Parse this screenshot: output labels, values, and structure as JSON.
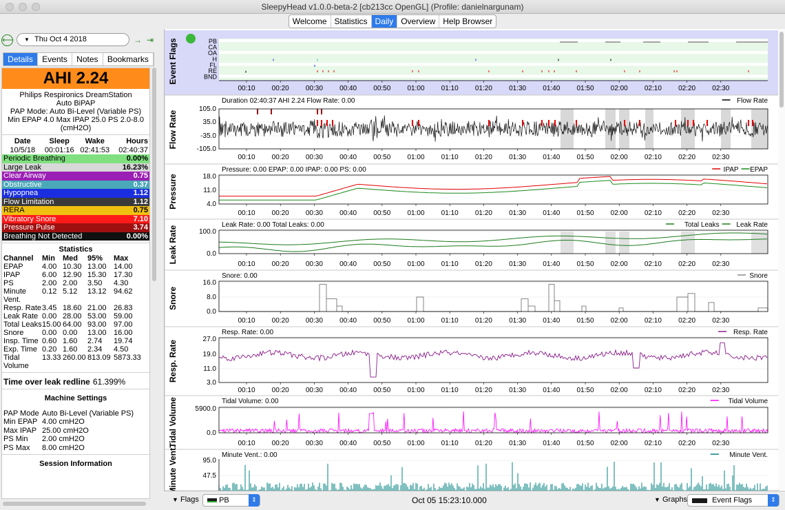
{
  "window": {
    "title": "SleepyHead v1.0.0-beta-2 [cb213cc OpenGL] (Profile: danielnargunam)"
  },
  "tabs": [
    "Welcome",
    "Statistics",
    "Daily",
    "Overview",
    "Help Browser"
  ],
  "active_tab": "Daily",
  "nav": {
    "date": "Thu Oct 4 2018",
    "back_icon": "back-arrow-icon",
    "forward_icon": "forward-arrow-icon",
    "last_icon": "jump-end-icon"
  },
  "left_tabs": [
    "Details",
    "Events",
    "Notes",
    "Bookmarks"
  ],
  "active_left_tab": "Details",
  "ahi": "AHI 2.24",
  "machine": {
    "name": "Philips Respironics DreamStation",
    "model": "Auto BiPAP",
    "mode_line": "PAP Mode: Auto Bi-Level (Variable PS)",
    "pressure_line": "Min EPAP 4.0 Max IPAP 25.0 PS 2.0-8.0",
    "unit": "(cmH2O)"
  },
  "sleep": {
    "headers": [
      "Date",
      "Sleep",
      "Wake",
      "Hours"
    ],
    "values": [
      "10/5/18",
      "00:01:16",
      "02:41:53",
      "02:40:37"
    ]
  },
  "events": [
    {
      "name": "Periodic Breathing",
      "value": "0.00%",
      "bg": "#80e080",
      "fg": "#000000"
    },
    {
      "name": "Large Leak",
      "value": "16.23%",
      "bg": "#d8d8d8",
      "fg": "#000000"
    },
    {
      "name": "Clear Airway",
      "value": "0.75",
      "bg": "#9a1fb4",
      "fg": "#ffffff"
    },
    {
      "name": "Obstructive",
      "value": "0.37",
      "bg": "#4aa8b8",
      "fg": "#ffffff"
    },
    {
      "name": "Hypopnea",
      "value": "1.12",
      "bg": "#1a2ee0",
      "fg": "#ffffff"
    },
    {
      "name": "Flow Limitation",
      "value": "1.12",
      "bg": "#3a3a3a",
      "fg": "#ffffff"
    },
    {
      "name": "RERA",
      "value": "0.75",
      "bg": "#f0c010",
      "fg": "#000000"
    },
    {
      "name": "Vibratory Snore",
      "value": "7.10",
      "bg": "#ff1a1a",
      "fg": "#ffffff"
    },
    {
      "name": "Pressure Pulse",
      "value": "3.74",
      "bg": "#a01010",
      "fg": "#ffffff"
    },
    {
      "name": "Breathing Not Detected",
      "value": "0.00%",
      "bg": "#101010",
      "fg": "#ffffff"
    }
  ],
  "stats": {
    "title": "Statistics",
    "headers": [
      "Channel",
      "Min",
      "Med",
      "95%",
      "Max"
    ],
    "rows": [
      [
        "EPAP",
        "4.00",
        "10.30",
        "13.00",
        "14.00"
      ],
      [
        "IPAP",
        "6.00",
        "12.90",
        "15.30",
        "17.30"
      ],
      [
        "PS",
        "2.00",
        "2.00",
        "3.50",
        "4.30"
      ],
      [
        "Minute Vent.",
        "0.12",
        "5.12",
        "13.12",
        "94.62"
      ],
      [
        "Resp. Rate",
        "3.45",
        "18.60",
        "21.00",
        "26.83"
      ],
      [
        "Leak Rate",
        "0.00",
        "28.00",
        "53.00",
        "59.00"
      ],
      [
        "Total Leaks",
        "15.00",
        "64.00",
        "93.00",
        "97.00"
      ],
      [
        "Snore",
        "0.00",
        "0.00",
        "13.00",
        "16.00"
      ],
      [
        "Insp. Time",
        "0.60",
        "1.60",
        "2.74",
        "19.74"
      ],
      [
        "Exp. Time",
        "0.20",
        "1.60",
        "2.34",
        "4.50"
      ],
      [
        "Tidal Volume",
        "13.33",
        "260.00",
        "813.09",
        "5873.33"
      ]
    ]
  },
  "leak_redline": {
    "label": "Time over leak redline",
    "value": "61.399%"
  },
  "machine_settings": {
    "title": "Machine Settings",
    "rows": [
      [
        "PAP Mode",
        "Auto Bi-Level (Variable PS)"
      ],
      [
        "Min EPAP",
        "4.00 cmH2O"
      ],
      [
        "Max IPAP",
        "25.00 cmH2O"
      ],
      [
        "PS Min",
        "2.00 cmH2O"
      ],
      [
        "PS Max",
        "8.00 cmH2O"
      ]
    ]
  },
  "session_info_title": "Session Information",
  "time_ticks": [
    "00:10",
    "00:20",
    "00:30",
    "00:40",
    "00:50",
    "01:00",
    "01:10",
    "01:20",
    "01:30",
    "01:40",
    "01:50",
    "02:00",
    "02:10",
    "02:20",
    "02:30"
  ],
  "graphs": {
    "flags": {
      "ylabel": "Event Flags",
      "labels": [
        "PB",
        "CA",
        "OA",
        "H",
        "FL",
        "RE",
        "BND"
      ]
    },
    "flow": {
      "ylabel": "Flow Rate",
      "caption": "Duration 02:40:37 AHI 2.24 Flow Rate: 0.00",
      "legend": [
        "Flow Rate"
      ],
      "ticks": [
        "105.0",
        "35.0",
        "-35.0",
        "-105.0"
      ]
    },
    "pressure": {
      "ylabel": "Pressure",
      "caption": "Pressure: 0.00 EPAP: 0.00 IPAP: 0.00 PS: 0.00",
      "legend": [
        "IPAP",
        "EPAP"
      ],
      "ticks": [
        "18.0",
        "11.0",
        "4.0"
      ]
    },
    "leak": {
      "ylabel": "Leak Rate",
      "caption": "Leak Rate: 0.00 Total Leaks: 0.00",
      "legend": [
        "Total Leaks",
        "Leak Rate"
      ],
      "ticks": [
        "100.0",
        "0.0"
      ]
    },
    "snore": {
      "ylabel": "Snore",
      "caption": "Snore: 0.00",
      "legend": [
        "Snore"
      ],
      "ticks": [
        "16.0",
        "8.0",
        "0.0"
      ]
    },
    "resp": {
      "ylabel": "Resp. Rate",
      "caption": "Resp. Rate: 0.00",
      "legend": [
        "Resp. Rate"
      ],
      "ticks": [
        "27.0",
        "19.0",
        "11.0",
        "3.0"
      ]
    },
    "tidal": {
      "ylabel": "Tidal Volume",
      "caption": "Tidal Volume: 0.00",
      "legend": [
        "Tidal Volume"
      ],
      "ticks": [
        "5900.0",
        "0.0"
      ]
    },
    "minute": {
      "ylabel": "Minute Vent.",
      "caption": "Minute Vent.: 0.00",
      "legend": [
        "Minute Vent."
      ],
      "ticks": [
        "95.0",
        "47.5"
      ]
    }
  },
  "bottom": {
    "flags_label": "Flags",
    "flags_value": "PB",
    "timestamp": "Oct 05 15:23:10.000",
    "graphs_label": "Graphs",
    "graphs_value": "Event Flags"
  },
  "colors": {
    "accent": "#2f7bea",
    "ahi_bg": "#ff8c1a",
    "ipap": "#e00000",
    "epap": "#1a8a1a",
    "leak": "#1a7a1a",
    "resp": "#8a1a8a",
    "tidal": "#ff00ff",
    "minute": "#008080",
    "flags_bg": "#d8d8f8"
  }
}
